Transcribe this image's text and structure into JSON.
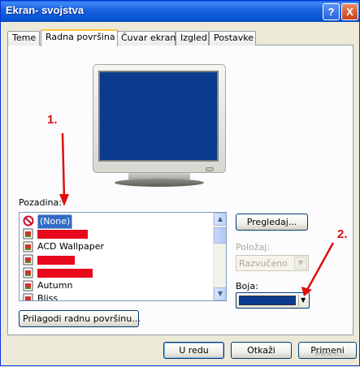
{
  "window": {
    "title": "Ekran- svojstva",
    "help_glyph": "?",
    "close_glyph": "X"
  },
  "tabs": [
    {
      "label": "Teme",
      "active": false
    },
    {
      "label": "Radna površina",
      "active": true
    },
    {
      "label": "Čuvar ekrana",
      "active": false
    },
    {
      "label": "Izgled",
      "active": false
    },
    {
      "label": "Postavke",
      "active": false
    }
  ],
  "background_section": {
    "label": "Pozadina:",
    "items": [
      {
        "text": "(None)",
        "selected": true,
        "icon": "none-icon",
        "redacted": false
      },
      {
        "text": "",
        "selected": false,
        "icon": "image-file-icon",
        "redacted": true
      },
      {
        "text": "ACD Wallpaper",
        "selected": false,
        "icon": "image-file-icon",
        "redacted": false
      },
      {
        "text": "",
        "selected": false,
        "icon": "image-file-icon",
        "redacted": true
      },
      {
        "text": "",
        "selected": false,
        "icon": "image-file-icon",
        "redacted": true
      },
      {
        "text": "Autumn",
        "selected": false,
        "icon": "image-file-icon",
        "redacted": false
      },
      {
        "text": "Bliss",
        "selected": false,
        "icon": "image-file-icon",
        "redacted": false
      }
    ],
    "browse_button": "Pregledaj...",
    "position_label": "Položaj:",
    "position_value": "Razvučeno",
    "color_label": "Boja:",
    "color_value": "#0a3b8e",
    "customize_button": "Prilagodi radnu površinu..."
  },
  "footer": {
    "ok": "U redu",
    "cancel": "Otkaži",
    "apply": "Primeni"
  },
  "annotations": {
    "first": "1.",
    "second": "2.",
    "accent_color": "#e00d0d"
  },
  "watermark": "www.it..."
}
